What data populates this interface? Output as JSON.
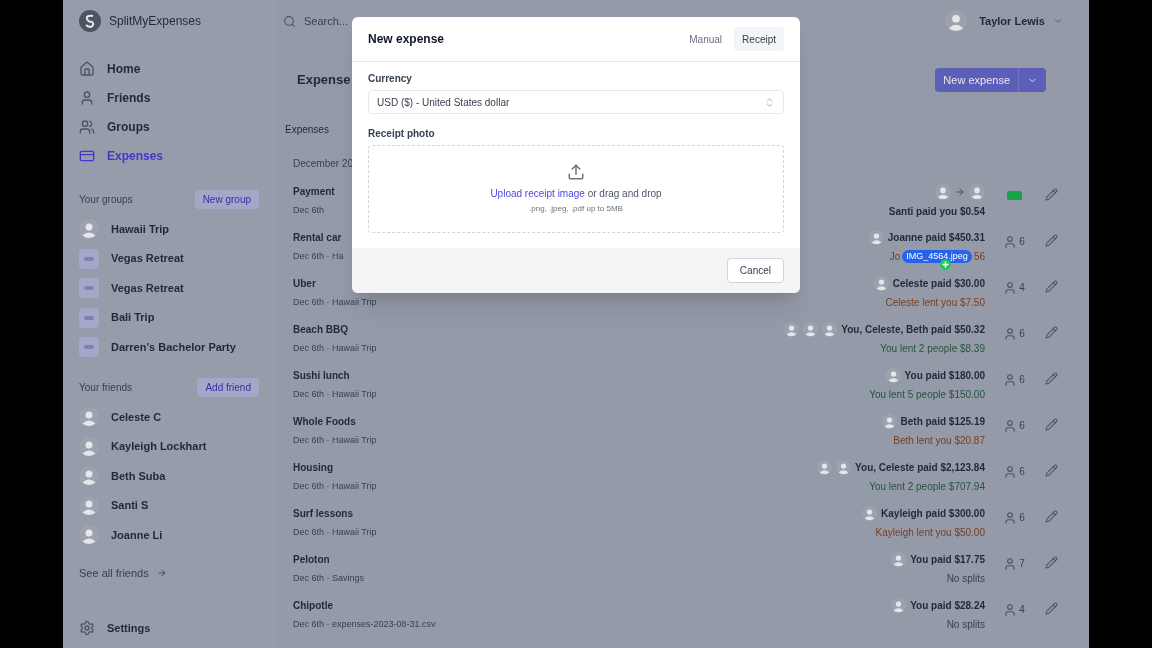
{
  "app": {
    "name": "SplitMyExpenses"
  },
  "search": {
    "placeholder": "Search..."
  },
  "user": {
    "name": "Taylor Lewis"
  },
  "sidebar": {
    "nav": [
      {
        "label": "Home",
        "selected": false
      },
      {
        "label": "Friends",
        "selected": false
      },
      {
        "label": "Groups",
        "selected": false
      },
      {
        "label": "Expenses",
        "selected": true
      }
    ],
    "groups_heading": "Your groups",
    "new_group": "New group",
    "groups": [
      {
        "name": "Hawaii Trip",
        "kind": "photo"
      },
      {
        "name": "Vegas Retreat",
        "kind": "initials"
      },
      {
        "name": "Vegas Retreat",
        "kind": "initials"
      },
      {
        "name": "Bali Trip",
        "kind": "initials"
      },
      {
        "name": "Darren's Bachelor Party",
        "kind": "initials"
      }
    ],
    "friends_heading": "Your friends",
    "add_friend": "Add friend",
    "friends": [
      {
        "name": "Celeste C"
      },
      {
        "name": "Kayleigh Lockhart"
      },
      {
        "name": "Beth Suba"
      },
      {
        "name": "Santi S"
      },
      {
        "name": "Joanne Li"
      }
    ],
    "see_all": "See all friends",
    "settings": "Settings"
  },
  "main": {
    "title": "Expense",
    "new_expense": "New expense",
    "tab": "Expenses",
    "month": "December 20",
    "rows": [
      {
        "name": "Payment",
        "meta": "Dec 6th",
        "kind": "payment",
        "payers": [
          {
            "kind": "avatar"
          },
          {
            "kind": "avatar"
          }
        ],
        "paid": "Santi paid you $0.54"
      },
      {
        "name": "Rental car",
        "meta": "Dec 6th · Ha",
        "kind": "expense",
        "payers": [
          {
            "kind": "avatar"
          }
        ],
        "paid": "Joanne paid $450.31",
        "balance_parts": [
          "Jo",
          "56"
        ],
        "drag": "IMG_4564.jpeg",
        "color": "#7a3d1c",
        "people": "6"
      },
      {
        "name": "Uber",
        "meta": "Dec 6th · Hawaii Trip",
        "kind": "expense",
        "payers": [
          {
            "kind": "avatar"
          }
        ],
        "paid": "Celeste paid $30.00",
        "balance": "Celeste lent you $7.50",
        "color": "#7a3d1c",
        "people": "4"
      },
      {
        "name": "Beach BBQ",
        "meta": "Dec 6th · Hawaii Trip",
        "kind": "expense",
        "payers": [
          {
            "kind": "avatar"
          },
          {
            "kind": "avatar"
          },
          {
            "kind": "avatar"
          }
        ],
        "paid": "You, Celeste, Beth paid $50.32",
        "balance": "You lent 2 people $8.39",
        "color": "#24553a",
        "people": "6"
      },
      {
        "name": "Sushi lunch",
        "meta": "Dec 6th · Hawaii Trip",
        "kind": "expense",
        "payers": [
          {
            "kind": "avatar"
          }
        ],
        "paid": "You paid $180.00",
        "balance": "You lent 5 people $150.00",
        "color": "#24553a",
        "people": "6"
      },
      {
        "name": "Whole Foods",
        "meta": "Dec 6th · Hawaii Trip",
        "kind": "expense",
        "payers": [
          {
            "kind": "avatar"
          }
        ],
        "paid": "Beth paid $125.19",
        "balance": "Beth lent you $20.87",
        "color": "#7a3d1c",
        "people": "6"
      },
      {
        "name": "Housing",
        "meta": "Dec 6th · Hawaii Trip",
        "kind": "expense",
        "payers": [
          {
            "kind": "avatar"
          },
          {
            "kind": "avatar"
          }
        ],
        "paid": "You, Celeste paid $2,123.84",
        "balance": "You lent 2 people $707.94",
        "color": "#24553a",
        "people": "6"
      },
      {
        "name": "Surf lessons",
        "meta": "Dec 6th · Hawaii Trip",
        "kind": "expense",
        "payers": [
          {
            "kind": "avatar"
          }
        ],
        "paid": "Kayleigh paid $300.00",
        "balance": "Kayleigh lent you $50.00",
        "color": "#7a3d1c",
        "people": "6"
      },
      {
        "name": "Peloton",
        "meta": "Dec 6th · Savings",
        "kind": "expense",
        "payers": [
          {
            "kind": "avatar"
          }
        ],
        "paid": "You paid $17.75",
        "balance": "No splits",
        "color": "#374151",
        "people": "7"
      },
      {
        "name": "Chipotle",
        "meta": "Dec 6th · expenses-2023-08-31.csv",
        "kind": "expense",
        "payers": [
          {
            "kind": "avatar"
          }
        ],
        "paid": "You paid $28.24",
        "balance": "No splits",
        "color": "#374151",
        "people": "4"
      }
    ]
  },
  "modal": {
    "title": "New expense",
    "tabs": [
      {
        "label": "Manual",
        "selected": false
      },
      {
        "label": "Receipt",
        "selected": true
      }
    ],
    "currency_label": "Currency",
    "currency": "USD ($) - United States dollar",
    "photo_label": "Receipt photo",
    "upload_link": "Upload receipt image",
    "upload_rest": "or drag and drop",
    "hint": ".png, .jpeg, .pdf up to 5MB",
    "cancel": "Cancel"
  }
}
